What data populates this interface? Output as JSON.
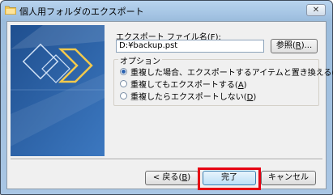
{
  "window": {
    "title": "個人用フォルダのエクスポート",
    "close_glyph": "✕"
  },
  "file": {
    "label_text": "エクスポート ファイル名",
    "label_accel": "F",
    "path_value": "D:¥backup.pst"
  },
  "browse_button": {
    "text": "参照",
    "accel": "R"
  },
  "options": {
    "title": "オプション",
    "items": [
      {
        "text": "重複した場合、エクスポートするアイテムと置き換える",
        "accel": "E",
        "selected": true
      },
      {
        "text": "重複してもエクスポートする",
        "accel": "A",
        "selected": false
      },
      {
        "text": "重複したらエクスポートしない",
        "accel": "D",
        "selected": false
      }
    ]
  },
  "buttons": {
    "back": {
      "prefix": "< 戻る",
      "accel": "B"
    },
    "finish": {
      "text": "完了"
    },
    "cancel": {
      "text": "キャンセル"
    }
  },
  "colors": {
    "highlight": "#e60012",
    "banner": "#2d5f9e",
    "arrow": "#f2c94c"
  }
}
